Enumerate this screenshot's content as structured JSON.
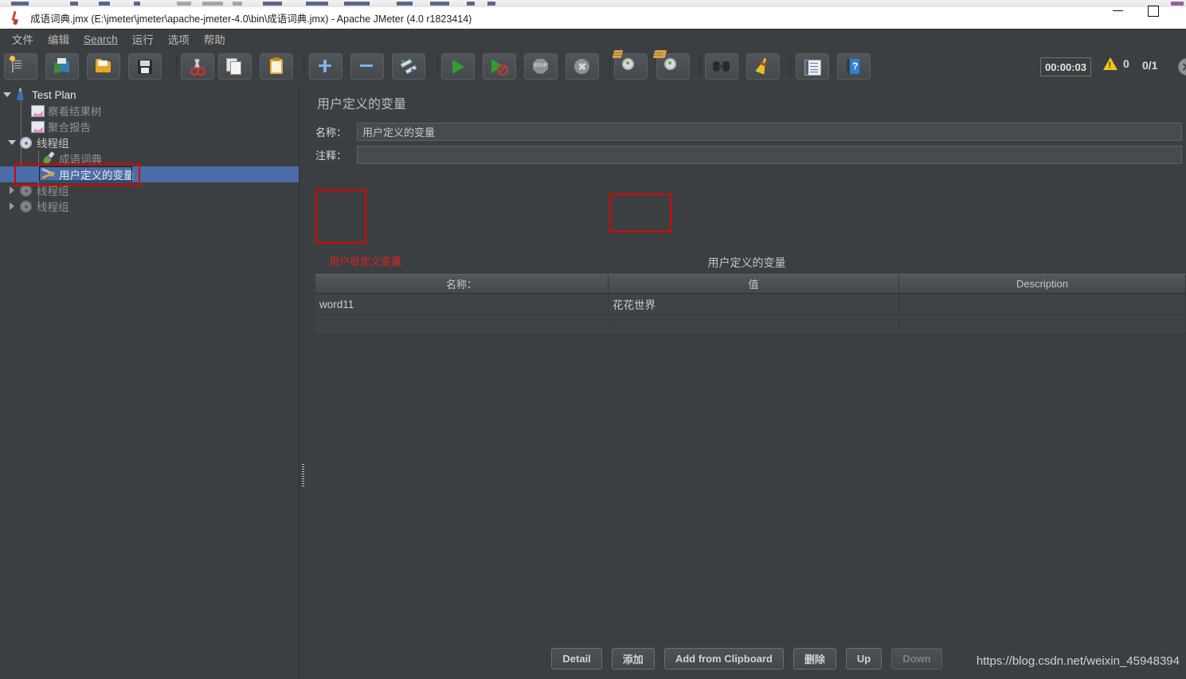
{
  "window": {
    "title": "成语词典.jmx (E:\\jmeter\\jmeter\\apache-jmeter-4.0\\bin\\成语词典.jmx) - Apache JMeter (4.0 r1823414)",
    "app_icon": "jmeter-flask-icon",
    "minimize_label": "—",
    "maximize_label": "□"
  },
  "menubar": {
    "items": [
      {
        "label": "文件",
        "name": "menu-file"
      },
      {
        "label": "编辑",
        "name": "menu-edit"
      },
      {
        "label": "Search",
        "name": "menu-search",
        "mnemonic": "S"
      },
      {
        "label": "运行",
        "name": "menu-run"
      },
      {
        "label": "选项",
        "name": "menu-options"
      },
      {
        "label": "帮助",
        "name": "menu-help"
      }
    ]
  },
  "toolbar": {
    "buttons": [
      {
        "icon": "new-test-plan-icon",
        "tooltip": "New"
      },
      {
        "icon": "templates-icon",
        "tooltip": "Templates"
      },
      {
        "icon": "open-folder-icon",
        "tooltip": "Open"
      },
      {
        "icon": "save-disk-icon",
        "tooltip": "Save"
      },
      {
        "icon": "cut-scissors-icon",
        "tooltip": "Cut"
      },
      {
        "icon": "copy-icon",
        "tooltip": "Copy"
      },
      {
        "icon": "paste-clipboard-icon",
        "tooltip": "Paste"
      },
      {
        "icon": "expand-all-plus-icon",
        "tooltip": "Expand All"
      },
      {
        "icon": "collapse-all-minus-icon",
        "tooltip": "Collapse All"
      },
      {
        "icon": "toggle-icon",
        "tooltip": "Toggle"
      },
      {
        "icon": "start-play-icon",
        "tooltip": "Start"
      },
      {
        "icon": "start-no-pauses-icon",
        "tooltip": "Start no pauses"
      },
      {
        "icon": "stop-icon",
        "tooltip": "Stop"
      },
      {
        "icon": "shutdown-icon",
        "tooltip": "Shutdown"
      },
      {
        "icon": "clear-icon",
        "tooltip": "Clear"
      },
      {
        "icon": "clear-all-icon",
        "tooltip": "Clear All"
      },
      {
        "icon": "search-binoculars-icon",
        "tooltip": "Search"
      },
      {
        "icon": "reset-search-broom-icon",
        "tooltip": "Reset Search"
      },
      {
        "icon": "function-helper-icon",
        "tooltip": "Function Helper Dialog"
      },
      {
        "icon": "help-book-icon",
        "tooltip": "Help"
      }
    ],
    "status": {
      "timer": "00:00:03",
      "warning_icon": "warning-triangle-icon",
      "warning_count": "0",
      "thread_count": "0/1",
      "edge_icon": "shutdown-circle-icon"
    }
  },
  "tree": {
    "nodes": [
      {
        "label": "Test Plan",
        "icon": "test-plan-flask-icon",
        "indent": 0,
        "twisty": "down",
        "state": "normal",
        "name": "tree-node-test-plan"
      },
      {
        "label": "察看结果树",
        "icon": "view-results-tree-icon",
        "indent": 1,
        "twisty": "none",
        "state": "dim",
        "name": "tree-node-view-results-tree"
      },
      {
        "label": "聚合报告",
        "icon": "aggregate-report-icon",
        "indent": 1,
        "twisty": "none",
        "state": "dim",
        "name": "tree-node-aggregate-report"
      },
      {
        "label": "线程组",
        "icon": "thread-group-gear-icon",
        "indent": 1,
        "twisty": "down",
        "state": "normal",
        "name": "tree-node-thread-group-1"
      },
      {
        "label": "成语词典",
        "icon": "http-sampler-pipette-icon",
        "indent": 2,
        "twisty": "none",
        "state": "dim",
        "name": "tree-node-chengyu-cidian"
      },
      {
        "label": "用户定义的变量",
        "icon": "user-defined-variables-tools-icon",
        "indent": 2,
        "twisty": "none",
        "state": "selected",
        "name": "tree-node-user-defined-variables"
      },
      {
        "label": "线程组",
        "icon": "thread-group-gear-disabled-icon",
        "indent": 1,
        "twisty": "right",
        "state": "disabled",
        "name": "tree-node-thread-group-2"
      },
      {
        "label": "线程组",
        "icon": "thread-group-gear-disabled-icon",
        "indent": 1,
        "twisty": "right",
        "state": "disabled",
        "name": "tree-node-thread-group-3"
      }
    ]
  },
  "main": {
    "panel_title": "用户定义的变量",
    "name_label": "名称：",
    "name_value": "用户定义的变量",
    "comment_label": "注释：",
    "comment_value": "",
    "table_caption": "用户定义的变量",
    "table": {
      "columns": [
        "名称：",
        "值",
        "Description"
      ],
      "rows": [
        {
          "name": "word11",
          "value": "花花世界",
          "description": ""
        }
      ]
    },
    "annotation_note": "用户自定义变量",
    "annotation_color": "#e22020",
    "buttons": [
      {
        "label": "Detail",
        "name": "detail-button",
        "disabled": false
      },
      {
        "label": "添加",
        "name": "add-button",
        "disabled": false
      },
      {
        "label": "Add from Clipboard",
        "name": "add-from-clipboard-button",
        "disabled": false
      },
      {
        "label": "删除",
        "name": "delete-button",
        "disabled": false
      },
      {
        "label": "Up",
        "name": "up-button",
        "disabled": false
      },
      {
        "label": "Down",
        "name": "down-button",
        "disabled": true
      }
    ],
    "watermark": "https://blog.csdn.net/weixin_45948394"
  },
  "colors": {
    "background": "#3c3f41",
    "selection": "#4a6da7",
    "annotation_red": "#e00000",
    "text": "#c7c7c7"
  }
}
